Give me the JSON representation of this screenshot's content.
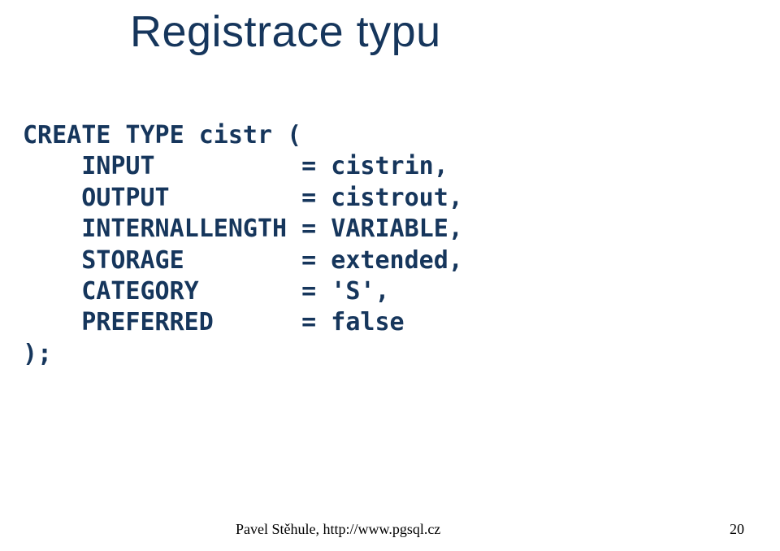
{
  "slide": {
    "title": "Registrace typu",
    "code": "CREATE TYPE cistr (\n    INPUT          = cistrin,\n    OUTPUT         = cistrout,\n    INTERNALLENGTH = VARIABLE,\n    STORAGE        = extended,\n    CATEGORY       = 'S',\n    PREFERRED      = false\n);",
    "footer_left": "Pavel Stěhule, http://www.pgsql.cz",
    "footer_right": "20"
  }
}
